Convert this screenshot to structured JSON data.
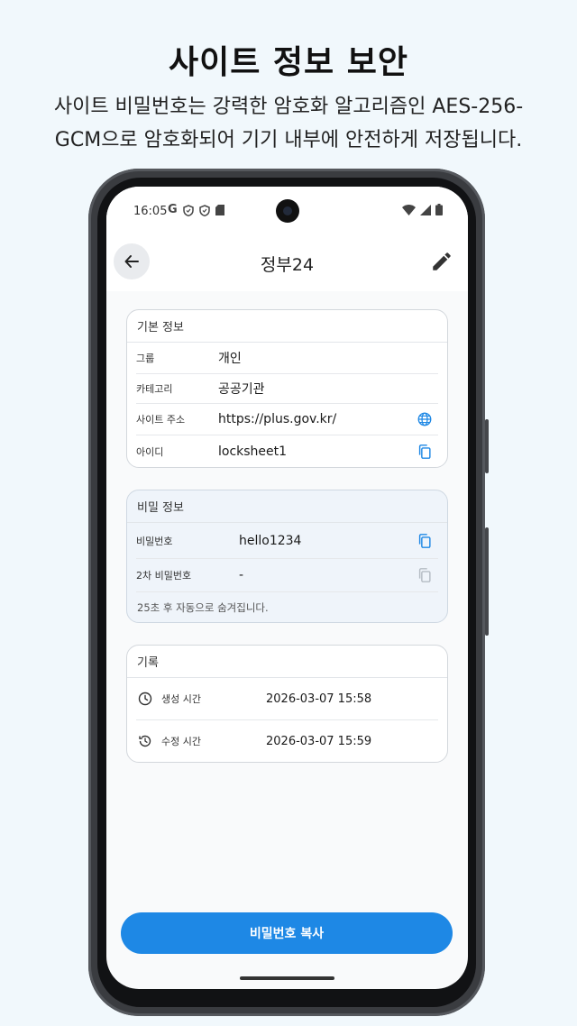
{
  "promo": {
    "title": "사이트 정보 보안",
    "subtitle_line1": "사이트 비밀번호는 강력한 암호화 알고리즘인 AES-256-",
    "subtitle_line2": "GCM으로 암호화되어 기기 내부에 안전하게 저장됩니다."
  },
  "statusbar": {
    "time": "16:05",
    "left_icons": [
      "G",
      "shield-icon",
      "shield-icon",
      "sd-card-icon"
    ],
    "right_icons": [
      "wifi-icon",
      "signal-icon",
      "battery-icon"
    ]
  },
  "appbar": {
    "title": "정부24",
    "back_icon": "arrow-left-icon",
    "edit_icon": "pencil-icon"
  },
  "basic_info": {
    "header": "기본 정보",
    "rows": [
      {
        "label": "그룹",
        "value": "개인"
      },
      {
        "label": "카테고리",
        "value": "공공기관"
      },
      {
        "label": "사이트 주소",
        "value": "https://plus.gov.kr/",
        "icon": "globe-icon"
      },
      {
        "label": "아이디",
        "value": "locksheet1",
        "icon": "copy-icon"
      }
    ]
  },
  "secret_info": {
    "header": "비밀 정보",
    "rows": [
      {
        "label": "비밀번호",
        "value": "hello1234",
        "icon": "copy-icon"
      },
      {
        "label": "2차 비밀번호",
        "value": "-",
        "icon": "copy-icon"
      }
    ],
    "note": "25초 후 자동으로 숨겨집니다."
  },
  "history": {
    "header": "기록",
    "rows": [
      {
        "label": "생성 시간",
        "value": "2026-03-07 15:58",
        "icon": "clock-icon"
      },
      {
        "label": "수정 시간",
        "value": "2026-03-07 15:59",
        "icon": "history-icon"
      }
    ]
  },
  "actions": {
    "copy_password": "비밀번호 복사"
  },
  "colors": {
    "accent": "#1e88e5",
    "background": "#f1f8fc",
    "secret_card": "#eff4fa"
  }
}
